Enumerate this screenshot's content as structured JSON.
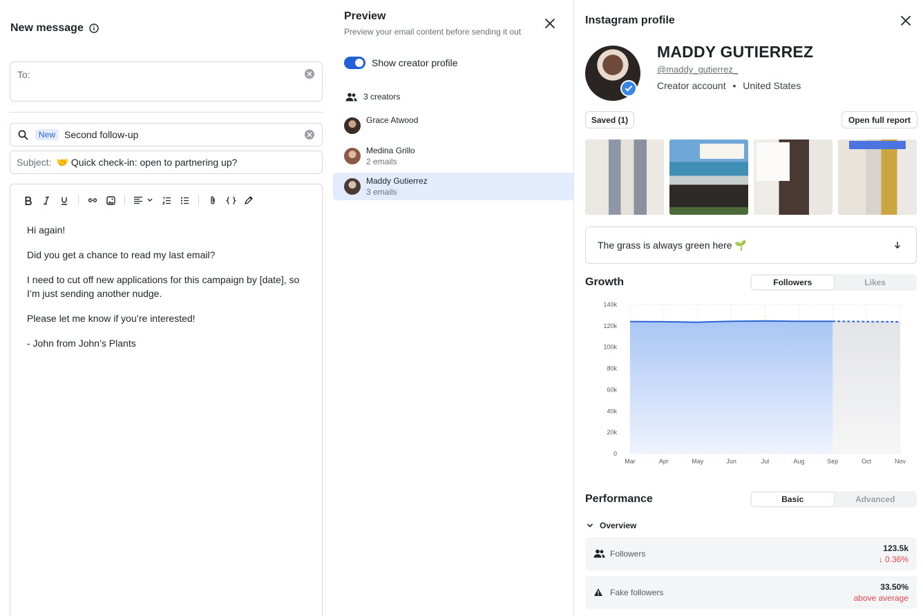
{
  "composer": {
    "title": "New message",
    "to_label": "To:",
    "template_badge": "New",
    "template_name": "Second follow-up",
    "subject_label": "Subject:",
    "subject_value": "🤝 Quick check-in: open to partnering up?",
    "body": [
      "Hi again!",
      "Did you get a chance to read my last email?",
      "I need to cut off new applications for this campaign by [date], so I’m just sending another nudge.",
      "Please let me know if you’re interested!",
      "- John from John’s Plants"
    ],
    "toolbar_icons": [
      "bold-icon",
      "italic-icon",
      "underline-icon",
      "link-icon",
      "image-icon",
      "align-icon",
      "numbered-list-icon",
      "bullet-list-icon",
      "attachment-icon",
      "code-icon",
      "signature-icon"
    ]
  },
  "preview": {
    "title": "Preview",
    "subtitle": "Preview your email content before sending it out",
    "toggle_label": "Show creator profile",
    "toggle_on": true,
    "creators_count": "3 creators",
    "creators": [
      {
        "name": "Grace Atwood",
        "count": "",
        "avatar_color": "#3b2c26",
        "active": false
      },
      {
        "name": "Medina Grillo",
        "count": "2 emails",
        "avatar_color": "#8a5a44",
        "active": false
      },
      {
        "name": "Maddy Gutierrez",
        "count": "3 emails",
        "avatar_color": "#4a3b36",
        "active": true
      }
    ]
  },
  "profile": {
    "title": "Instagram profile",
    "name": "MADDY GUTIERREZ",
    "handle": "@maddy_gutierrez_",
    "account_type": "Creator account",
    "separator": "•",
    "country": "United States",
    "saved_label": "Saved (1)",
    "report_label": "Open full report",
    "bio": "The grass is always green here 🌱",
    "growth_title": "Growth",
    "growth_tabs": [
      "Followers",
      "Likes"
    ],
    "performance_title": "Performance",
    "performance_tabs": [
      "Basic",
      "Advanced"
    ],
    "overview_label": "Overview",
    "metrics": [
      {
        "label": "Followers",
        "value": "123.5k",
        "sub": "↓ 0.36%",
        "icon": "users-icon"
      },
      {
        "label": "Fake followers",
        "value": "33.50%",
        "sub": "above average",
        "icon": "warning-icon"
      }
    ],
    "accent": "#2160d8",
    "negative": "#e5484d"
  },
  "chart_data": {
    "type": "area",
    "x": [
      "Mar",
      "Apr",
      "May",
      "Jun",
      "Jul",
      "Aug",
      "Sep",
      "Oct",
      "Nov"
    ],
    "y_ticks": [
      "0",
      "20k",
      "40k",
      "60k",
      "80k",
      "100k",
      "120k",
      "140k"
    ],
    "ylim": [
      0,
      140000
    ],
    "series": [
      {
        "values": [
          124000,
          123900,
          123400,
          124300,
          124600,
          124300,
          124300,
          null,
          null
        ]
      },
      {
        "projected": true,
        "values": [
          null,
          null,
          null,
          null,
          null,
          null,
          124300,
          124000,
          123800
        ]
      }
    ],
    "grid": true
  }
}
